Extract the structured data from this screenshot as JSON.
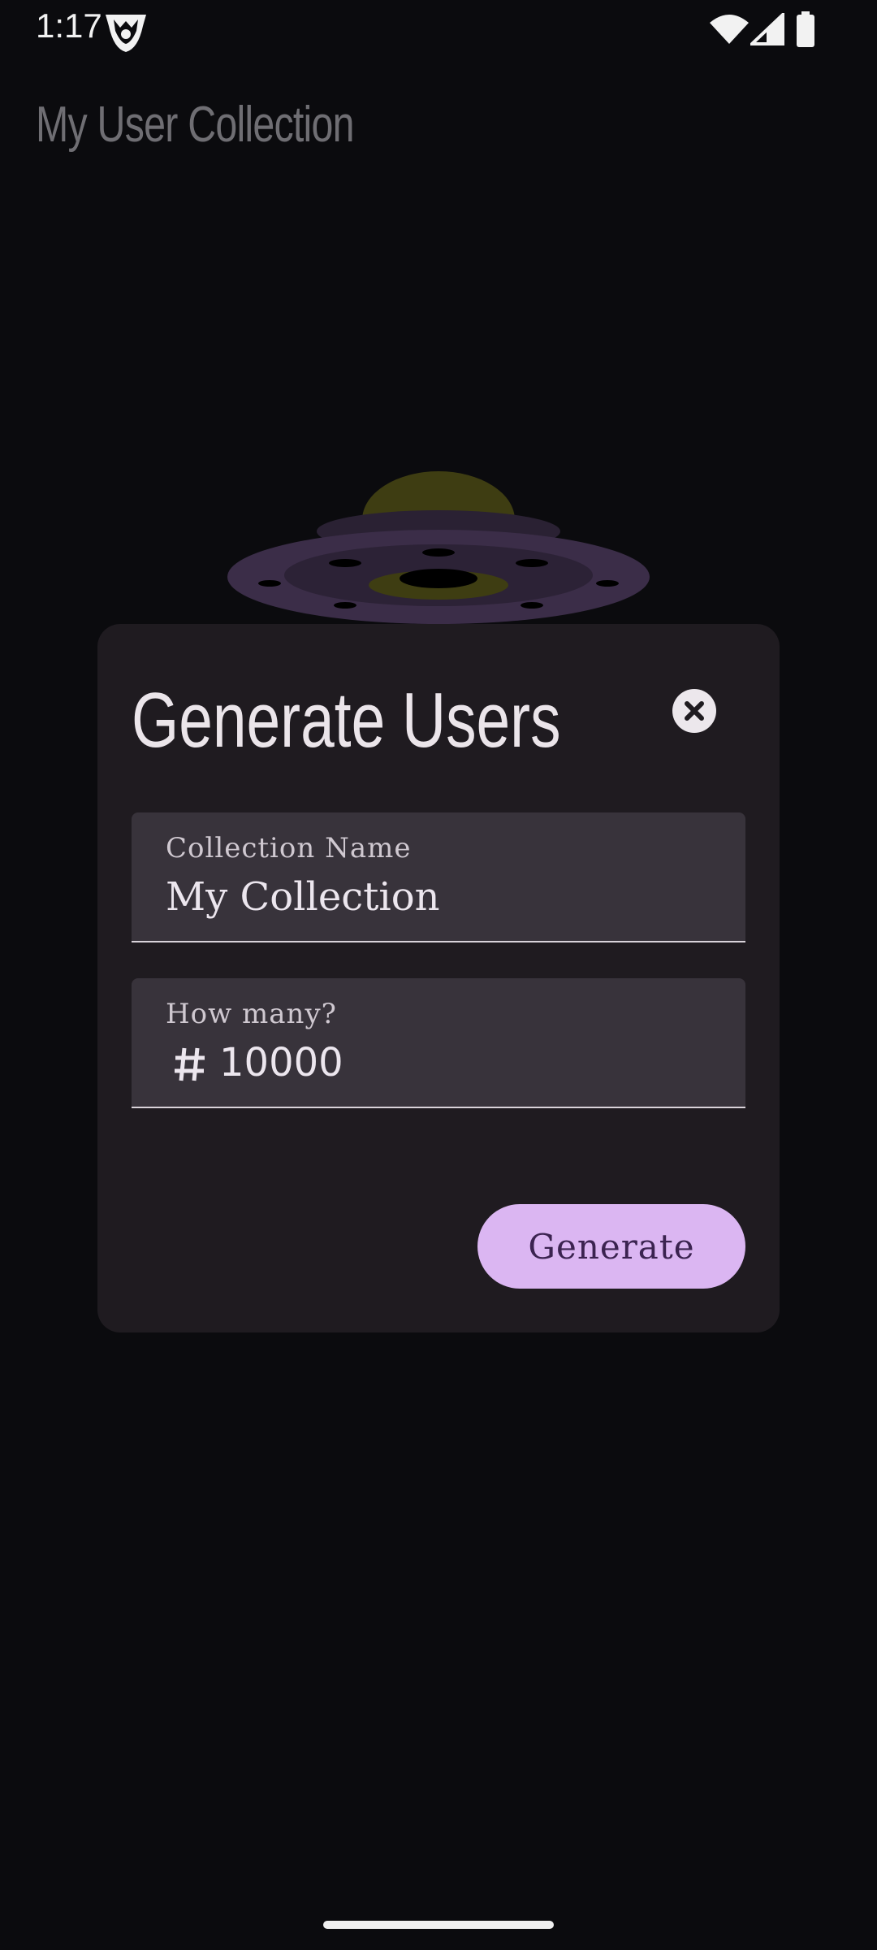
{
  "status_bar": {
    "time": "1:17"
  },
  "app_bar": {
    "title": "My User Collection"
  },
  "dialog": {
    "title": "Generate Users",
    "collection_field": {
      "label": "Collection Name",
      "value": "My Collection"
    },
    "count_field": {
      "label": "How many?",
      "value": "10000"
    },
    "generate_label": "Generate"
  },
  "colors": {
    "background": "#0b0b0e",
    "dialog": "#1f1b20",
    "field": "#38333b",
    "accent_button": "#dbb6f2",
    "accent_text": "#3b2350"
  },
  "icons": [
    "app-logo-icon",
    "wifi-icon",
    "signal-icon",
    "battery-icon",
    "close-icon",
    "hash-icon"
  ]
}
